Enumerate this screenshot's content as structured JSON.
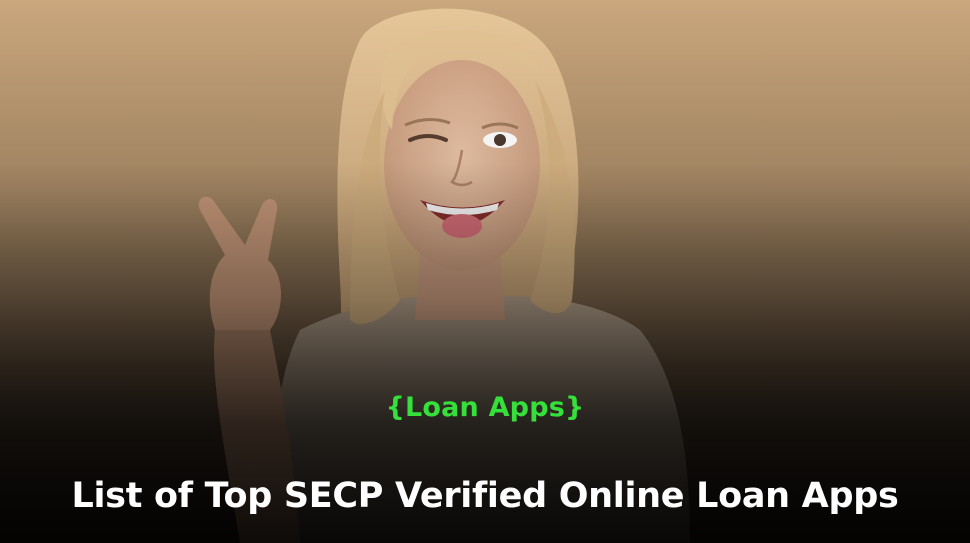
{
  "banner": {
    "category_tag": "{Loan Apps}",
    "headline": "List of Top SECP Verified Online Loan Apps"
  },
  "colors": {
    "tag": "#35e03a",
    "headline": "#ffffff",
    "background_top": "#c9a57a",
    "background_bottom": "#000000"
  }
}
